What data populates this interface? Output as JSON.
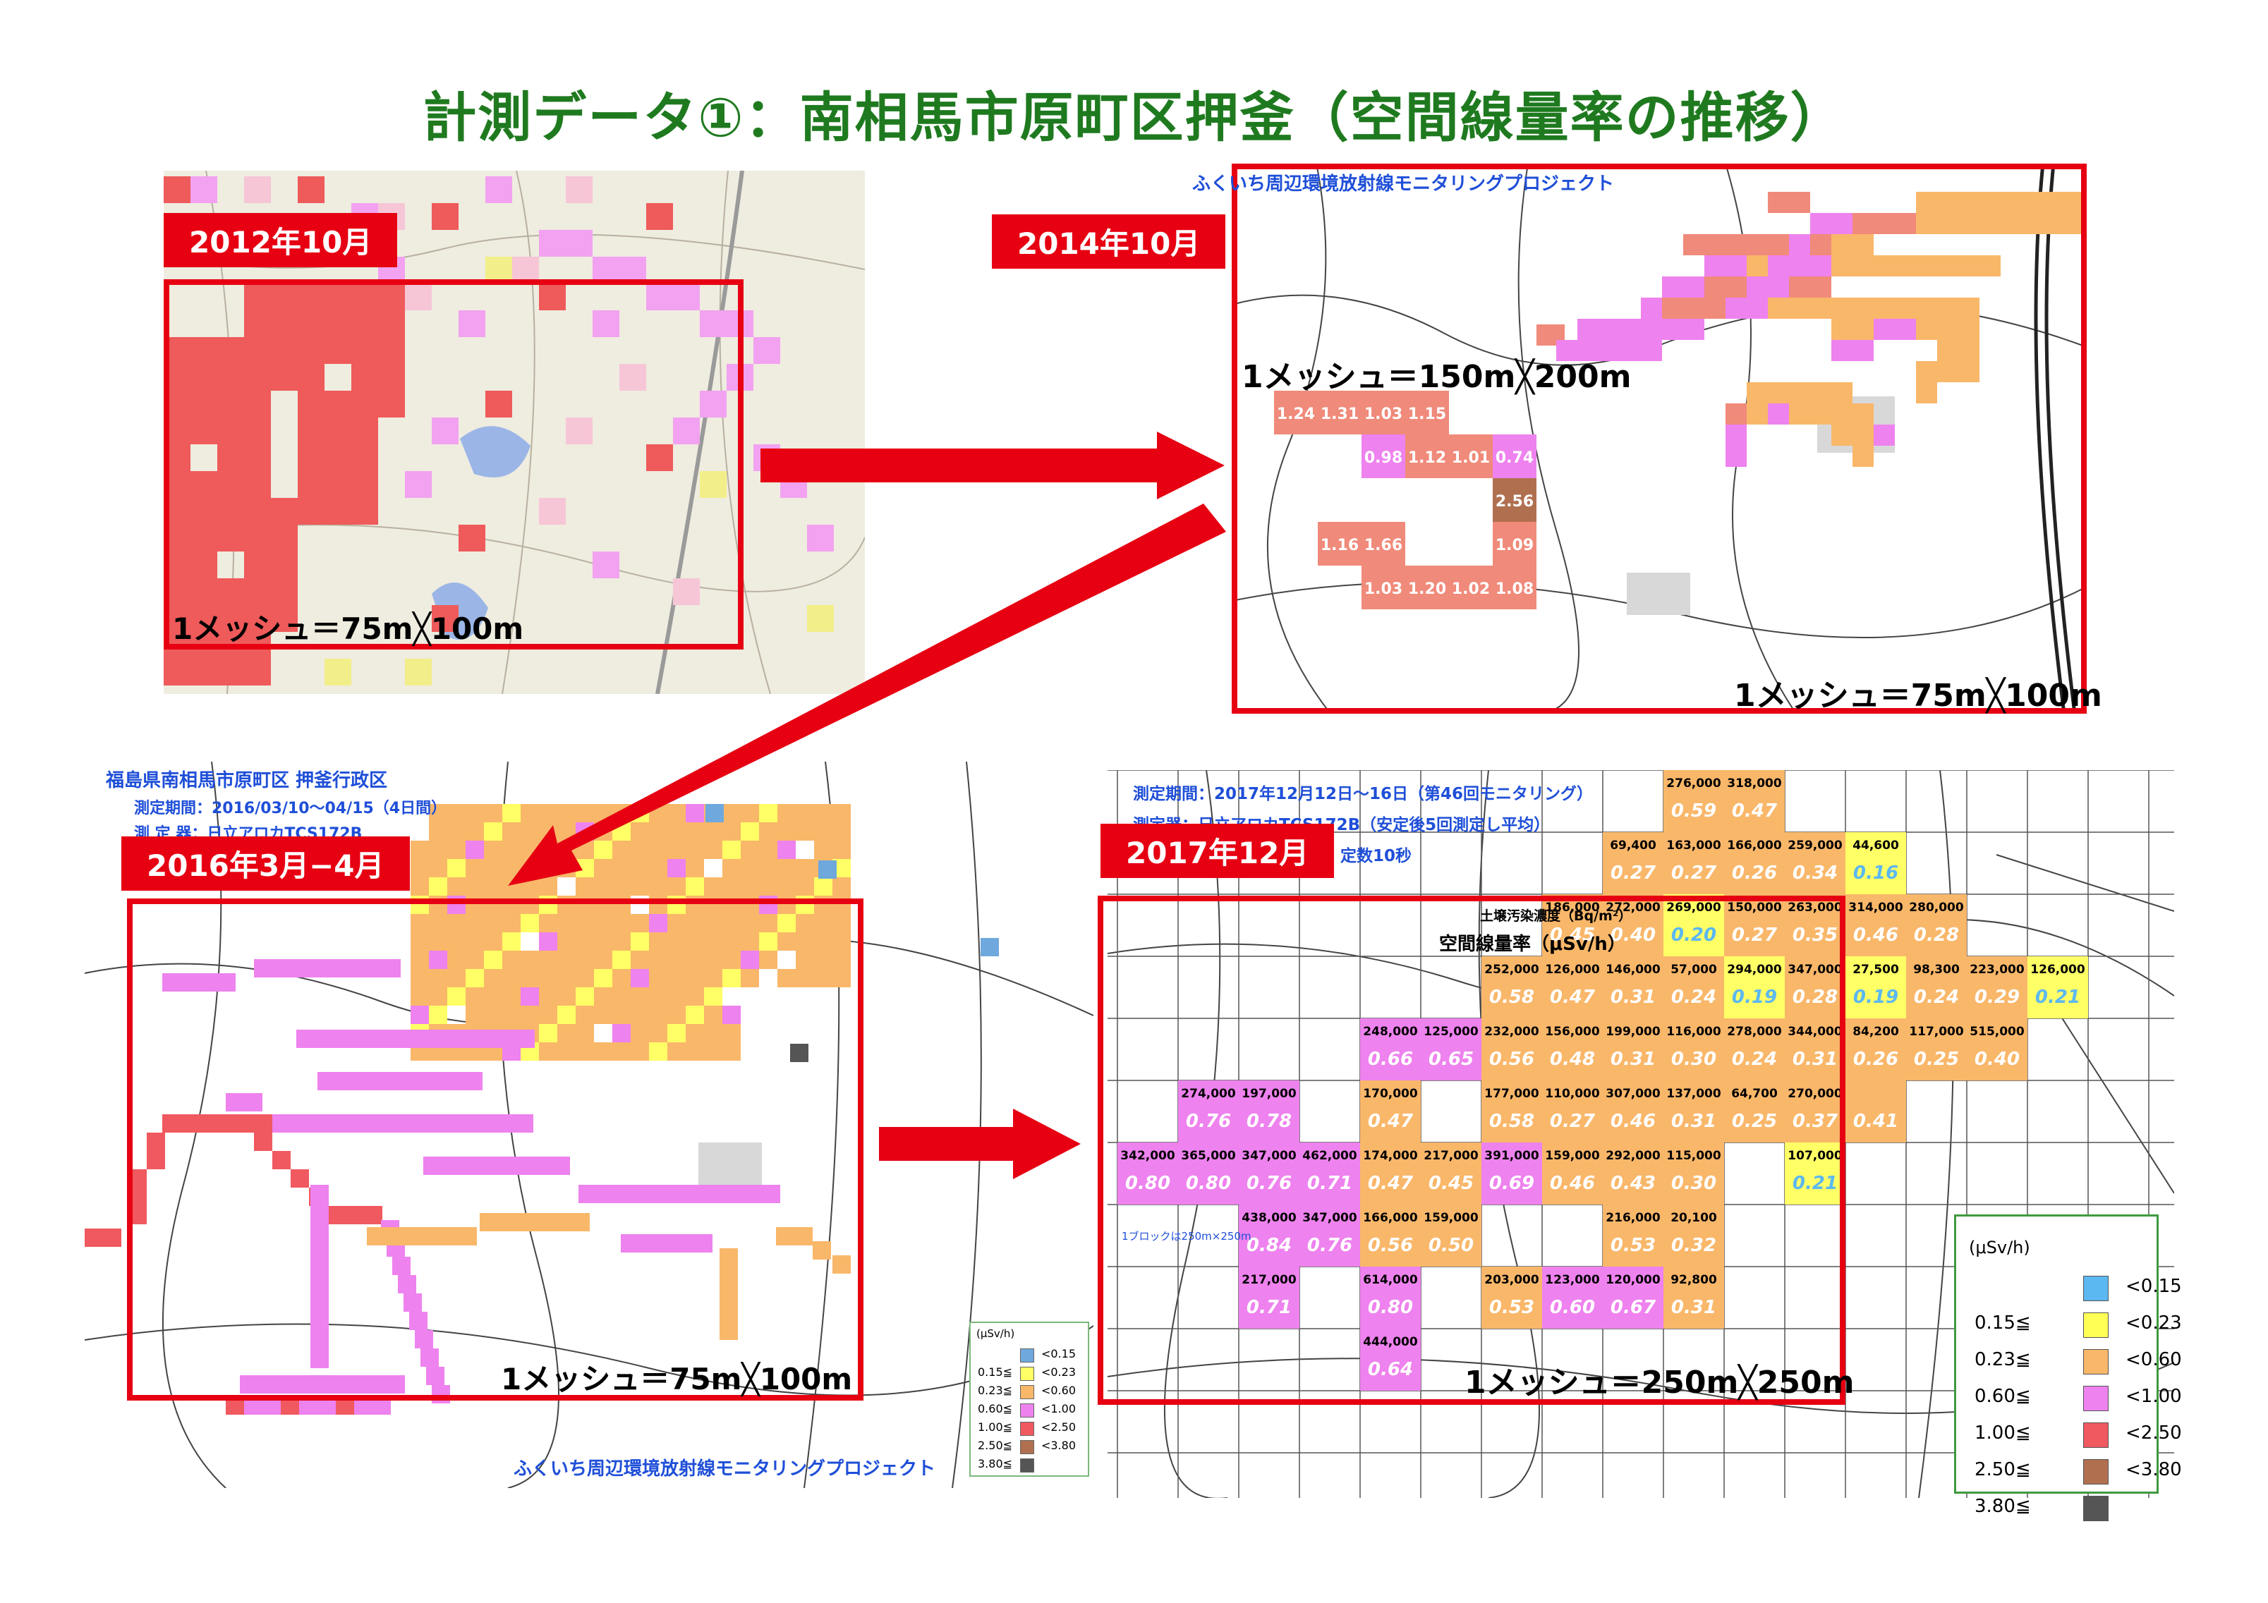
{
  "title": "計測データ①：南相馬市原町区押釜（空間線量率の推移）",
  "panels": {
    "p2012": {
      "date_label": "2012年10月",
      "mesh_label": "1メッシュ＝75m╳100m"
    },
    "p2014": {
      "date_label": "2014年10月",
      "header": "ふくいち周辺環境放射線モニタリングプロジェクト",
      "mesh_label_top": "1メッシュ＝150m╳200m",
      "mesh_label_bottom": "1メッシュ＝75m╳100m",
      "values_big": [
        "1.24",
        "1.31",
        "1.03",
        "1.15",
        "0.98",
        "1.12",
        "1.01",
        "0.74",
        "2.56",
        "1.16",
        "1.66",
        "1.09",
        "1.03",
        "1.20",
        "1.02",
        "1.08"
      ]
    },
    "p2016": {
      "date_label": "2016年3月−4月",
      "header_line1": "福島県南相馬市原町区 押釜行政区",
      "header_line2": "測定期間：2016/03/10〜04/15（4日間）",
      "header_line3": "測 定 器：日立アロカTCS172B",
      "mesh_label": "1メッシュ＝75m╳100m",
      "footer": "ふくいち周辺環境放射線モニタリングプロジェクト",
      "legend": {
        "unit": "(μSv/h)",
        "rows": [
          {
            "lo": "",
            "hi": "<0.15",
            "color": "#6fa8dc"
          },
          {
            "lo": "0.15≦",
            "hi": "<0.23",
            "color": "#ffff66"
          },
          {
            "lo": "0.23≦",
            "hi": "<0.60",
            "color": "#f9b76a"
          },
          {
            "lo": "0.60≦",
            "hi": "<1.00",
            "color": "#ee82ee"
          },
          {
            "lo": "1.00≦",
            "hi": "<2.50",
            "color": "#f0595f"
          },
          {
            "lo": "2.50≦",
            "hi": "<3.80",
            "color": "#b07050"
          },
          {
            "lo": "3.80≦",
            "hi": "",
            "color": "#555555"
          }
        ]
      }
    },
    "p2017": {
      "date_label": "2017年12月",
      "header_line1": "測定期間：2017年12月12日〜16日（第46回モニタリング）",
      "header_line2": "測定器：日立アロカTCS172B（安定後5回測定し平均）",
      "header_line3": "定数10秒",
      "soil_label": "土壌汚染濃度（Bq/m²）",
      "dose_label": "空間線量率（μSv/h）",
      "block_note": "1ブロックは250m×250m",
      "mesh_label": "1メッシュ＝250m╳250m",
      "cells": [
        {
          "c": 9,
          "r": 0,
          "bq": "276,000",
          "sv": "0.59",
          "color": "#f9b76a"
        },
        {
          "c": 10,
          "r": 0,
          "bq": "318,000",
          "sv": "0.47",
          "color": "#f9b76a"
        },
        {
          "c": 8,
          "r": 1,
          "bq": "69,400",
          "sv": "0.27",
          "color": "#f9b76a"
        },
        {
          "c": 9,
          "r": 1,
          "bq": "163,000",
          "sv": "0.27",
          "color": "#f9b76a"
        },
        {
          "c": 10,
          "r": 1,
          "bq": "166,000",
          "sv": "0.26",
          "color": "#f9b76a"
        },
        {
          "c": 11,
          "r": 1,
          "bq": "259,000",
          "sv": "0.34",
          "color": "#f9b76a"
        },
        {
          "c": 12,
          "r": 1,
          "bq": "44,600",
          "sv": "0.16",
          "color": "#ffff66"
        },
        {
          "c": 7,
          "r": 2,
          "bq": "186,000",
          "sv": "0.45",
          "color": "#f9b76a"
        },
        {
          "c": 8,
          "r": 2,
          "bq": "272,000",
          "sv": "0.40",
          "color": "#f9b76a"
        },
        {
          "c": 9,
          "r": 2,
          "bq": "269,000",
          "sv": "0.20",
          "color": "#ffff66"
        },
        {
          "c": 10,
          "r": 2,
          "bq": "150,000",
          "sv": "0.27",
          "color": "#f9b76a"
        },
        {
          "c": 11,
          "r": 2,
          "bq": "263,000",
          "sv": "0.35",
          "color": "#f9b76a"
        },
        {
          "c": 12,
          "r": 2,
          "bq": "314,000",
          "sv": "0.46",
          "color": "#f9b76a"
        },
        {
          "c": 13,
          "r": 2,
          "bq": "280,000",
          "sv": "0.28",
          "color": "#f9b76a"
        },
        {
          "c": 6,
          "r": 3,
          "bq": "252,000",
          "sv": "0.58",
          "color": "#f9b76a"
        },
        {
          "c": 7,
          "r": 3,
          "bq": "126,000",
          "sv": "0.47",
          "color": "#f9b76a"
        },
        {
          "c": 8,
          "r": 3,
          "bq": "146,000",
          "sv": "0.31",
          "color": "#f9b76a"
        },
        {
          "c": 9,
          "r": 3,
          "bq": "57,000",
          "sv": "0.24",
          "color": "#f9b76a"
        },
        {
          "c": 10,
          "r": 3,
          "bq": "294,000",
          "sv": "0.19",
          "color": "#ffff66"
        },
        {
          "c": 11,
          "r": 3,
          "bq": "347,000",
          "sv": "0.28",
          "color": "#f9b76a"
        },
        {
          "c": 12,
          "r": 3,
          "bq": "27,500",
          "sv": "0.19",
          "color": "#ffff66"
        },
        {
          "c": 13,
          "r": 3,
          "bq": "98,300",
          "sv": "0.24",
          "color": "#f9b76a"
        },
        {
          "c": 14,
          "r": 3,
          "bq": "223,000",
          "sv": "0.29",
          "color": "#f9b76a"
        },
        {
          "c": 15,
          "r": 3,
          "bq": "126,000",
          "sv": "0.21",
          "color": "#ffff66"
        },
        {
          "c": 4,
          "r": 4,
          "bq": "248,000",
          "sv": "0.66",
          "color": "#ee82ee"
        },
        {
          "c": 5,
          "r": 4,
          "bq": "125,000",
          "sv": "0.65",
          "color": "#ee82ee"
        },
        {
          "c": 6,
          "r": 4,
          "bq": "232,000",
          "sv": "0.56",
          "color": "#f9b76a"
        },
        {
          "c": 7,
          "r": 4,
          "bq": "156,000",
          "sv": "0.48",
          "color": "#f9b76a"
        },
        {
          "c": 8,
          "r": 4,
          "bq": "199,000",
          "sv": "0.31",
          "color": "#f9b76a"
        },
        {
          "c": 9,
          "r": 4,
          "bq": "116,000",
          "sv": "0.30",
          "color": "#f9b76a"
        },
        {
          "c": 10,
          "r": 4,
          "bq": "278,000",
          "sv": "0.24",
          "color": "#f9b76a"
        },
        {
          "c": 11,
          "r": 4,
          "bq": "344,000",
          "sv": "0.31",
          "color": "#f9b76a"
        },
        {
          "c": 12,
          "r": 4,
          "bq": "84,200",
          "sv": "0.26",
          "color": "#f9b76a"
        },
        {
          "c": 13,
          "r": 4,
          "bq": "117,000",
          "sv": "0.25",
          "color": "#f9b76a"
        },
        {
          "c": 14,
          "r": 4,
          "bq": "515,000",
          "sv": "0.40",
          "color": "#f9b76a"
        },
        {
          "c": 1,
          "r": 5,
          "bq": "274,000",
          "sv": "0.76",
          "color": "#ee82ee"
        },
        {
          "c": 2,
          "r": 5,
          "bq": "197,000",
          "sv": "0.78",
          "color": "#ee82ee"
        },
        {
          "c": 4,
          "r": 5,
          "bq": "170,000",
          "sv": "0.47",
          "color": "#f9b76a"
        },
        {
          "c": 6,
          "r": 5,
          "bq": "177,000",
          "sv": "0.58",
          "color": "#f9b76a"
        },
        {
          "c": 7,
          "r": 5,
          "bq": "110,000",
          "sv": "0.27",
          "color": "#f9b76a"
        },
        {
          "c": 8,
          "r": 5,
          "bq": "307,000",
          "sv": "0.46",
          "color": "#f9b76a"
        },
        {
          "c": 9,
          "r": 5,
          "bq": "137,000",
          "sv": "0.31",
          "color": "#f9b76a"
        },
        {
          "c": 10,
          "r": 5,
          "bq": "64,700",
          "sv": "0.25",
          "color": "#f9b76a"
        },
        {
          "c": 11,
          "r": 5,
          "bq": "270,000",
          "sv": "0.37",
          "color": "#f9b76a"
        },
        {
          "c": 12,
          "r": 5,
          "bq": "",
          "sv": "0.41",
          "color": "#f9b76a"
        },
        {
          "c": 0,
          "r": 6,
          "bq": "342,000",
          "sv": "0.80",
          "color": "#ee82ee"
        },
        {
          "c": 1,
          "r": 6,
          "bq": "365,000",
          "sv": "0.80",
          "color": "#ee82ee"
        },
        {
          "c": 2,
          "r": 6,
          "bq": "347,000",
          "sv": "0.76",
          "color": "#ee82ee"
        },
        {
          "c": 3,
          "r": 6,
          "bq": "462,000",
          "sv": "0.71",
          "color": "#ee82ee"
        },
        {
          "c": 4,
          "r": 6,
          "bq": "174,000",
          "sv": "0.47",
          "color": "#f9b76a"
        },
        {
          "c": 5,
          "r": 6,
          "bq": "217,000",
          "sv": "0.45",
          "color": "#f9b76a"
        },
        {
          "c": 6,
          "r": 6,
          "bq": "391,000",
          "sv": "0.69",
          "color": "#ee82ee"
        },
        {
          "c": 7,
          "r": 6,
          "bq": "159,000",
          "sv": "0.46",
          "color": "#f9b76a"
        },
        {
          "c": 8,
          "r": 6,
          "bq": "292,000",
          "sv": "0.43",
          "color": "#f9b76a"
        },
        {
          "c": 9,
          "r": 6,
          "bq": "115,000",
          "sv": "0.30",
          "color": "#f9b76a"
        },
        {
          "c": 11,
          "r": 6,
          "bq": "107,000",
          "sv": "0.21",
          "color": "#ffff66"
        },
        {
          "c": 2,
          "r": 7,
          "bq": "438,000",
          "sv": "0.84",
          "color": "#ee82ee"
        },
        {
          "c": 3,
          "r": 7,
          "bq": "347,000",
          "sv": "0.76",
          "color": "#ee82ee"
        },
        {
          "c": 4,
          "r": 7,
          "bq": "166,000",
          "sv": "0.56",
          "color": "#f9b76a"
        },
        {
          "c": 5,
          "r": 7,
          "bq": "159,000",
          "sv": "0.50",
          "color": "#f9b76a"
        },
        {
          "c": 8,
          "r": 7,
          "bq": "216,000",
          "sv": "0.53",
          "color": "#f9b76a"
        },
        {
          "c": 9,
          "r": 7,
          "bq": "20,100",
          "sv": "0.32",
          "color": "#f9b76a"
        },
        {
          "c": 2,
          "r": 8,
          "bq": "217,000",
          "sv": "0.71",
          "color": "#ee82ee"
        },
        {
          "c": 4,
          "r": 8,
          "bq": "614,000",
          "sv": "0.80",
          "color": "#ee82ee"
        },
        {
          "c": 6,
          "r": 8,
          "bq": "203,000",
          "sv": "0.53",
          "color": "#f9b76a"
        },
        {
          "c": 7,
          "r": 8,
          "bq": "123,000",
          "sv": "0.60",
          "color": "#ee82ee"
        },
        {
          "c": 8,
          "r": 8,
          "bq": "120,000",
          "sv": "0.67",
          "color": "#ee82ee"
        },
        {
          "c": 9,
          "r": 8,
          "bq": "92,800",
          "sv": "0.31",
          "color": "#f9b76a"
        },
        {
          "c": 4,
          "r": 9,
          "bq": "444,000",
          "sv": "0.64",
          "color": "#ee82ee"
        }
      ],
      "legend": {
        "unit": "(μSv/h)",
        "rows": [
          {
            "lo": "",
            "hi": "<0.15",
            "color": "#5bb8f0"
          },
          {
            "lo": "0.15≦",
            "hi": "<0.23",
            "color": "#ffff55"
          },
          {
            "lo": "0.23≦",
            "hi": "<0.60",
            "color": "#f9b76a"
          },
          {
            "lo": "0.60≦",
            "hi": "<1.00",
            "color": "#ee82ee"
          },
          {
            "lo": "1.00≦",
            "hi": "<2.50",
            "color": "#f0595f"
          },
          {
            "lo": "2.50≦",
            "hi": "<3.80",
            "color": "#b07050"
          },
          {
            "lo": "3.80≦",
            "hi": "",
            "color": "#555555"
          }
        ]
      }
    }
  },
  "colors": {
    "title_green": "#1f7a1f",
    "frame_red": "#e60012",
    "arrow_red": "#e60012"
  }
}
